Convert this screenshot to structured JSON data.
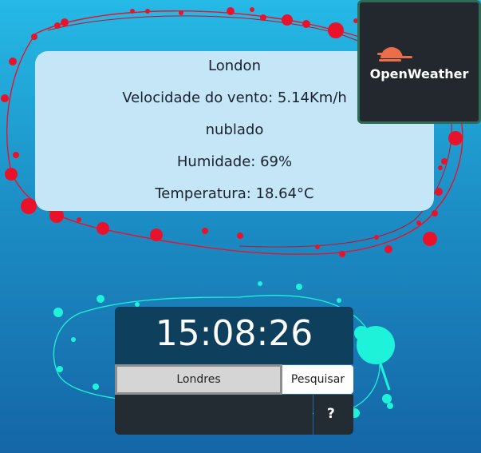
{
  "weather": {
    "city": "London",
    "wind_speed": "Velocidade do vento: 5.14Km/h",
    "description": "nublado",
    "humidity": "Humidade: 69%",
    "temperature": "Temperatura: 18.64°C"
  },
  "logo": {
    "text": "OpenWeather",
    "icon": "openweather-sun-icon"
  },
  "clock": {
    "time": "15:08:26"
  },
  "search": {
    "value": "Londres",
    "button_label": "Pesquisar"
  },
  "help": {
    "label": "?",
    "icon": "question-icon"
  },
  "colors": {
    "background_top": "#25b9e6",
    "background_bottom": "#1566a6",
    "red_splatter": "#e8132b",
    "cyan_splatter": "#1ef2d8",
    "logo_orange": "#eb6e4b"
  }
}
